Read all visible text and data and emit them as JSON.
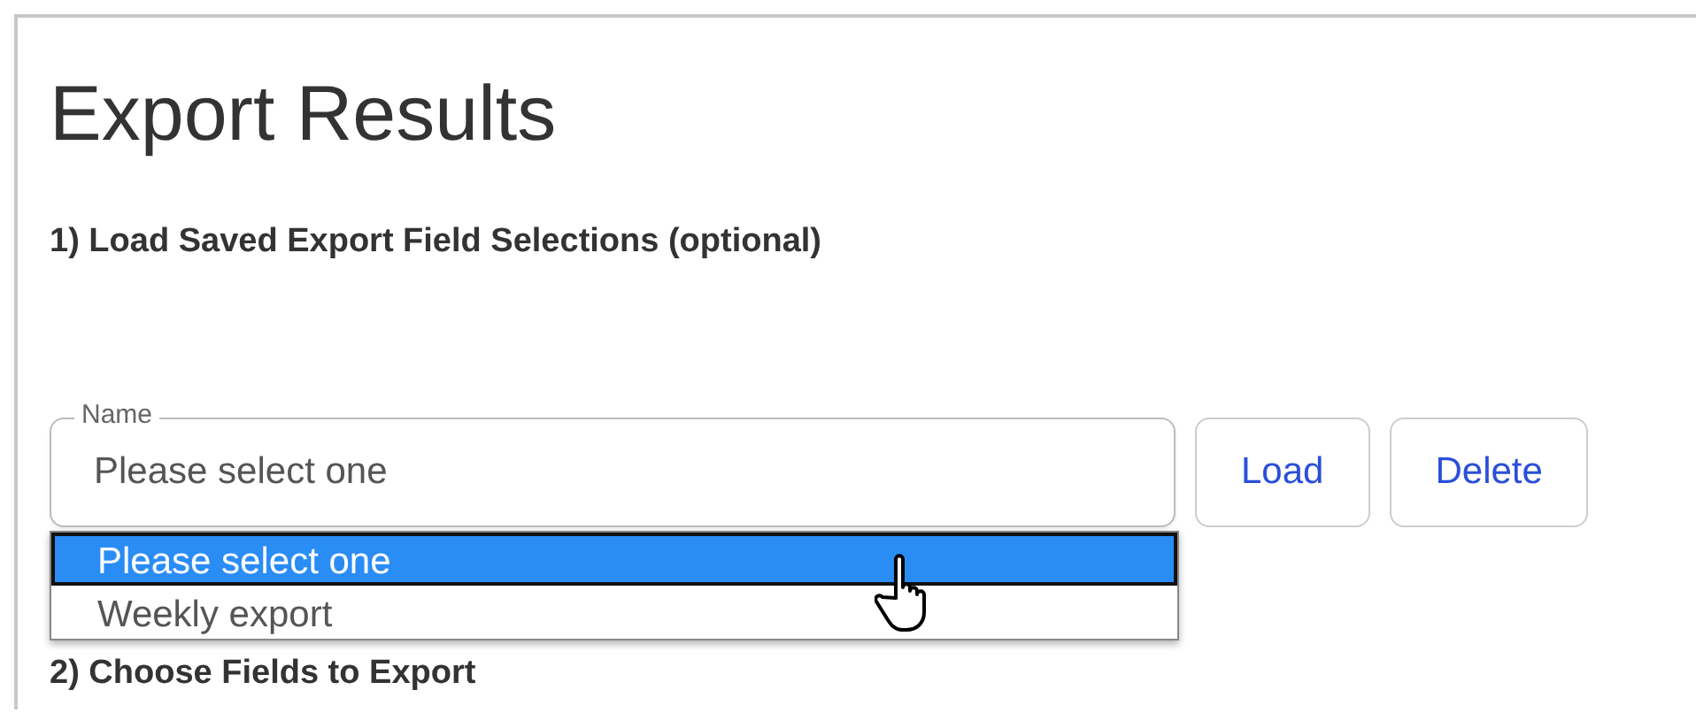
{
  "title": "Export Results",
  "section_1": {
    "heading": "1) Load Saved Export Field Selections (optional)",
    "name_field": {
      "label": "Name",
      "value": "Please select one",
      "expanded": true,
      "options": [
        {
          "label": "Please select one",
          "selected": true
        },
        {
          "label": "Weekly export",
          "selected": false
        }
      ]
    },
    "buttons": [
      "Load",
      "Delete"
    ]
  },
  "section_2": {
    "heading": "2) Choose Fields to Export"
  }
}
